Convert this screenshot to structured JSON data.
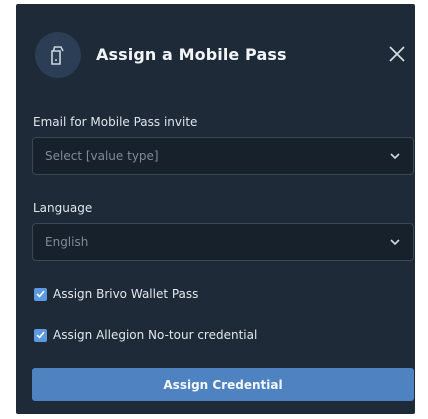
{
  "dialog": {
    "title": "Assign a Mobile Pass"
  },
  "email_field": {
    "label": "Email for Mobile Pass invite",
    "placeholder": "Select [value type]"
  },
  "language_field": {
    "label": "Language",
    "value": "English"
  },
  "options": [
    {
      "label": "Assign Brivo Wallet Pass",
      "checked": true
    },
    {
      "label": "Assign Allegion No-tour credential",
      "checked": true
    }
  ],
  "actions": {
    "submit_label": "Assign Credential"
  },
  "colors": {
    "background": "#1e2a37",
    "input_background": "#17212c",
    "accent": "#4f82c1",
    "checkbox": "#5b9ae0"
  },
  "icons": {
    "header": "mobile-pass-icon",
    "close": "close-icon",
    "dropdown": "chevron-down-icon",
    "check": "checkmark-icon"
  }
}
